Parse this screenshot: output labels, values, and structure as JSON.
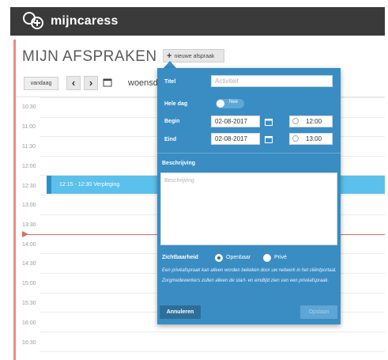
{
  "app": {
    "name": "mijncaress"
  },
  "page": {
    "title": "MIJN AFSPRAKEN",
    "new_button": "nieuwe afspraak"
  },
  "nav": {
    "today": "vandaag",
    "prev": "‹",
    "next": "›",
    "date_title": "woensd"
  },
  "hours": [
    "10:30",
    "11:00",
    "11:30",
    "12:00",
    "12:30",
    "13:00",
    "13:30",
    "14:00",
    "14:30",
    "15:00",
    "15:30",
    "16:00",
    "16:30"
  ],
  "event": {
    "text": "12:15 - 12:30  Verpleging"
  },
  "form": {
    "title_label": "Titel",
    "title_placeholder": "Activiteit",
    "allday_label": "Hele dag",
    "allday_value": "Nee",
    "begin_label": "Begin",
    "begin_date": "02-08-2017",
    "begin_time": "12:00",
    "end_label": "Eind",
    "end_date": "02-08-2017",
    "end_time": "13:00",
    "description_label": "Beschrijving",
    "description_placeholder": "Beschrijving",
    "visibility_label": "Zichtbaarheid",
    "visibility_options": [
      "Openbaar",
      "Privé"
    ],
    "visibility_selected": "Openbaar",
    "info_text": "Een privéafspraak kan alleen worden bekeken door uw netwerk in het cliëntportaal. Zorgmedewerkers zullen alleen de start- en eindtijd zien van een privéafspraak.",
    "cancel_label": "Annuleren",
    "save_label": "Opslaan"
  },
  "colors": {
    "topbar": "#3a3a3a",
    "popup": "#3a8dc3",
    "event": "#5bc0eb",
    "now": "#e06b5f"
  }
}
